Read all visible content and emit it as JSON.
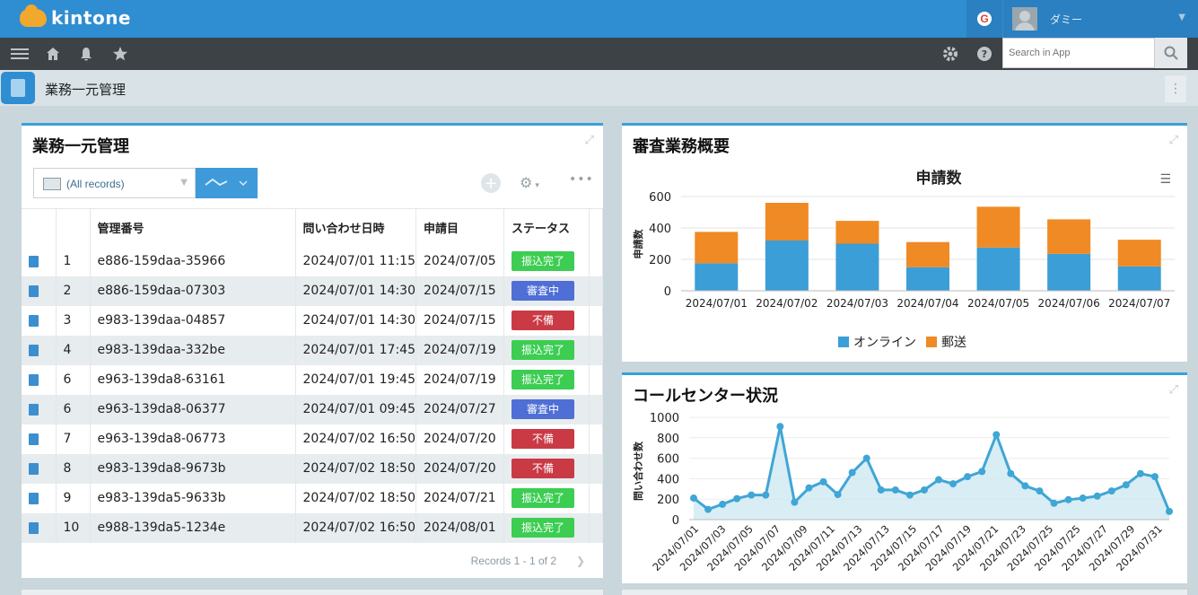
{
  "header": {
    "brand": "kintone",
    "google_letter": "G",
    "user_name": "ダミー"
  },
  "navbar": {
    "search_placeholder": "Search in App"
  },
  "app": {
    "title": "業務一元管理"
  },
  "records_panel": {
    "title": "業務一元管理",
    "view_label": "(All records)",
    "columns": [
      "",
      "",
      "管理番号",
      "問い合わせ日時",
      "申請目",
      "ステータス"
    ],
    "rows": [
      {
        "no": "1",
        "id": "e886-159daa-35966",
        "datetime": "2024/07/01 11:15",
        "date": "2024/07/05",
        "status": "振込完了",
        "kind": "green"
      },
      {
        "no": "2",
        "id": "e886-159daa-07303",
        "datetime": "2024/07/01 14:30",
        "date": "2024/07/15",
        "status": "審査中",
        "kind": "blue"
      },
      {
        "no": "3",
        "id": "e983-139daa-04857",
        "datetime": "2024/07/01 14:30",
        "date": "2024/07/15",
        "status": "不備",
        "kind": "red"
      },
      {
        "no": "4",
        "id": "e983-139daa-332be",
        "datetime": "2024/07/01 17:45",
        "date": "2024/07/19",
        "status": "振込完了",
        "kind": "green"
      },
      {
        "no": "6",
        "id": "e963-139da8-63161",
        "datetime": "2024/07/01 19:45",
        "date": "2024/07/19",
        "status": "振込完了",
        "kind": "green"
      },
      {
        "no": "6",
        "id": "e963-139da8-06377",
        "datetime": "2024/07/01 09:45",
        "date": "2024/07/27",
        "status": "審査中",
        "kind": "blue"
      },
      {
        "no": "7",
        "id": "e963-139da8-06773",
        "datetime": "2024/07/02 16:50",
        "date": "2024/07/20",
        "status": "不備",
        "kind": "red"
      },
      {
        "no": "8",
        "id": "e983-139da8-9673b",
        "datetime": "2024/07/02 18:50",
        "date": "2024/07/20",
        "status": "不備",
        "kind": "red"
      },
      {
        "no": "9",
        "id": "e983-139da5-9633b",
        "datetime": "2024/07/02 18:50",
        "date": "2024/07/21",
        "status": "振込完了",
        "kind": "green"
      },
      {
        "no": "10",
        "id": "e988-139da5-1234e",
        "datetime": "2024/07/02 16:50",
        "date": "2024/08/01",
        "status": "振込完了",
        "kind": "green"
      }
    ],
    "pager": "Records 1 - 1 of 2"
  },
  "review_panel": {
    "title": "審査業務概要"
  },
  "callcenter_panel": {
    "title": "コールセンター状況"
  },
  "colors": {
    "online": "#3b9ed6",
    "mail": "#f08a24",
    "line": "#3fa6d5",
    "area": "#cfe9f3"
  },
  "chart_data": [
    {
      "type": "bar",
      "stacked": true,
      "title": "申請数",
      "ylabel": "申請数",
      "ylim": [
        0,
        600
      ],
      "yticks": [
        0,
        200,
        400,
        600
      ],
      "categories": [
        "2024/07/01",
        "2024/07/02",
        "2024/07/03",
        "2024/07/04",
        "2024/07/05",
        "2024/07/06",
        "2024/07/07"
      ],
      "series": [
        {
          "name": "オンライン",
          "values": [
            175,
            320,
            300,
            150,
            275,
            235,
            155
          ]
        },
        {
          "name": "郵送",
          "values": [
            200,
            240,
            145,
            160,
            260,
            220,
            170
          ]
        }
      ],
      "legend": "bottom"
    },
    {
      "type": "area",
      "ylabel": "問い合わせ数",
      "ylim": [
        0,
        1000
      ],
      "yticks": [
        0,
        200,
        400,
        600,
        800,
        1000
      ],
      "tick_labels": [
        "2024/07/01",
        "2024/07/03",
        "2024/07/05",
        "2024/07/07",
        "2024/07/09",
        "2024/07/11",
        "2024/07/13",
        "2024/07/13",
        "2024/07/15",
        "2024/07/17",
        "2024/07/19",
        "2024/07/21",
        "2024/07/23",
        "2024/07/25",
        "2024/07/25",
        "2024/07/27",
        "2024/07/29",
        "2024/07/31"
      ],
      "values": [
        210,
        100,
        150,
        205,
        240,
        240,
        910,
        170,
        310,
        370,
        245,
        460,
        600,
        290,
        290,
        240,
        290,
        390,
        350,
        420,
        470,
        830,
        450,
        330,
        280,
        160,
        195,
        210,
        230,
        280,
        340,
        450,
        420,
        80
      ]
    }
  ]
}
